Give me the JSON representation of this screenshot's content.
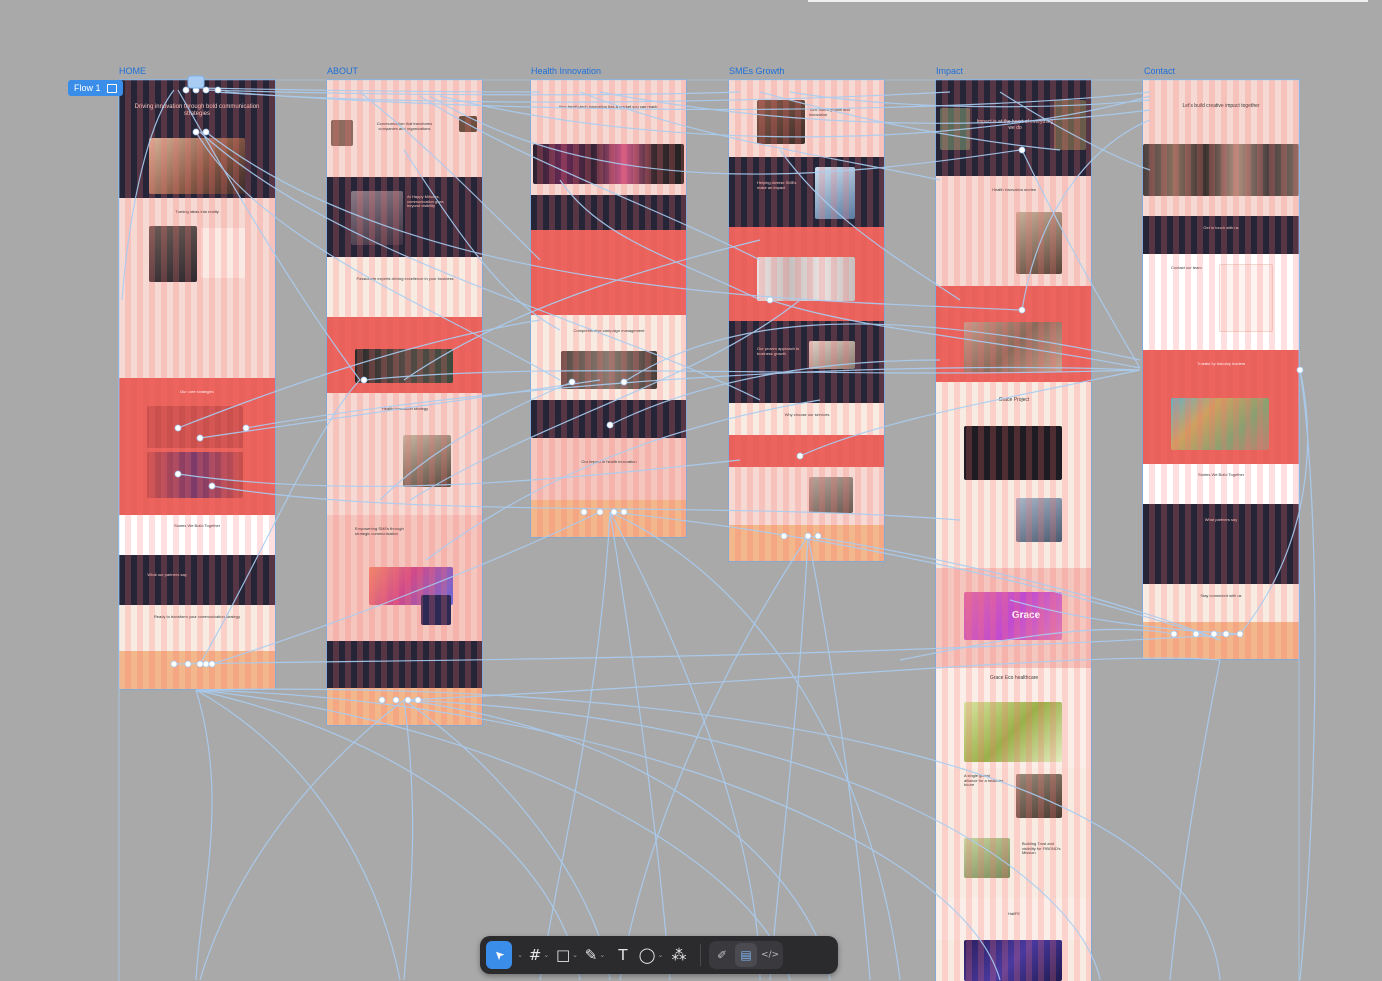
{
  "flow_badge": {
    "label": "Flow 1"
  },
  "frames": [
    {
      "id": "home",
      "label": "HOME"
    },
    {
      "id": "about",
      "label": "ABOUT"
    },
    {
      "id": "health",
      "label": "Health Innovation"
    },
    {
      "id": "smes",
      "label": "SMEs Growth"
    },
    {
      "id": "impact",
      "label": "Impact"
    },
    {
      "id": "contact",
      "label": "Contact"
    }
  ],
  "home": {
    "hero_title": "Driving innovation through bold communication strategies",
    "section_2": "Turning ideas into reality",
    "section_3": "Our core strategies",
    "section_4": "Stories We Build Together",
    "section_5": "What our partners say",
    "section_6": "Ready to transform your communication strategy"
  },
  "about": {
    "hero_title": "Communication that transforms companies and organizations",
    "section_2": "At Happy Minutes, communication goes beyond visibility",
    "section_3": "Passionate experts driving excellence in your business",
    "section_4": "Health innovation strategy",
    "section_5": "Empowering SMEs through strategic communication"
  },
  "health": {
    "hero_title": "Your health-tech innovation has a market you can reach",
    "section_2": "Comprehensive campaign management",
    "section_3": "Our impact in health innovation"
  },
  "smes": {
    "hero_title": "Turn SMEs growth and innovation",
    "section_2": "Helping diverse SMEs make an impact",
    "section_3": "Why choose our services",
    "section_4": "Our proven approach to business growth"
  },
  "impact": {
    "hero_title": "Impact is at the heart of everything we do",
    "section_2": "Health innovation stories",
    "grace_title": "Grace Project",
    "grace_logo": "Grace",
    "grace_eco": "Grace Eco healthcare",
    "section_3": "A single global alliance for a healthier future",
    "section_4": "Building Trust and visibility for FIBOND's Mission",
    "section_5": "HallFE"
  },
  "contact": {
    "hero_title": "Let's build creative impact together",
    "section_2": "Get in touch with us",
    "section_3": "Contact our team",
    "section_4": "Trusted by industry leaders",
    "section_5": "Stories We Build Together",
    "section_6": "What partners say",
    "section_7": "Stay connected with us"
  },
  "toolbar": {
    "tools": [
      {
        "name": "move-tool",
        "icon": "cursor-icon",
        "glyph": "➤"
      },
      {
        "name": "frame-tool",
        "icon": "frame-icon",
        "glyph": "#"
      },
      {
        "name": "shape-tool",
        "icon": "rectangle-icon",
        "glyph": "□"
      },
      {
        "name": "pen-tool",
        "icon": "pen-icon",
        "glyph": "✎"
      },
      {
        "name": "text-tool",
        "icon": "text-icon",
        "glyph": "T"
      },
      {
        "name": "comment-tool",
        "icon": "comment-icon",
        "glyph": "◯"
      },
      {
        "name": "actions-tool",
        "icon": "components-icon",
        "glyph": "⁂"
      }
    ],
    "modes": [
      {
        "name": "draw-mode",
        "icon": "draw-icon",
        "glyph": "✐"
      },
      {
        "name": "design-mode",
        "icon": "design-icon",
        "glyph": "▤"
      },
      {
        "name": "dev-mode",
        "icon": "code-icon",
        "glyph": "</>"
      }
    ]
  },
  "colors": {
    "canvas": "#a9a9a9",
    "navy": "#262538",
    "coral": "#e8615b",
    "blush": "#f6d9d2",
    "cream": "#f8ece2",
    "peach": "#f2b78a",
    "prototype_wire": "#a9cdf2",
    "selection": "#3b8dea"
  }
}
